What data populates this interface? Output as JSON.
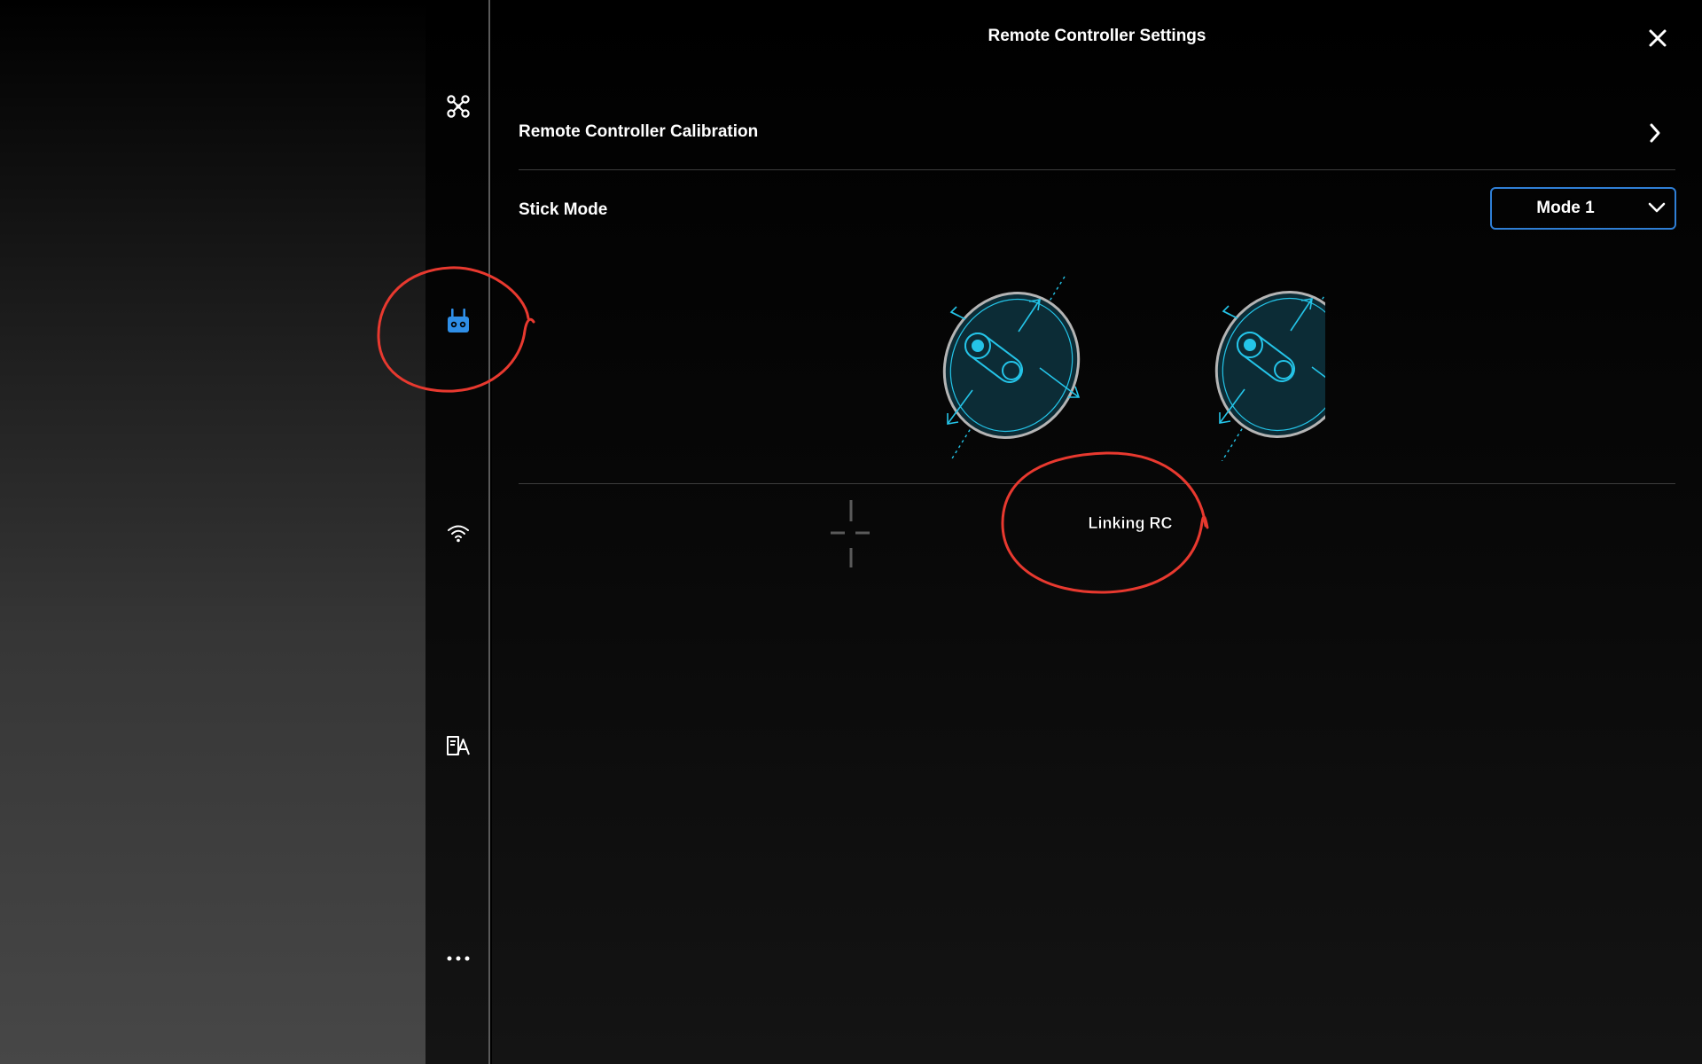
{
  "header": {
    "title": "Remote Controller Settings",
    "close_icon": "close-icon"
  },
  "sidebar": {
    "items": [
      {
        "name": "aircraft",
        "icon": "drone-icon",
        "active": false
      },
      {
        "name": "remote-controller",
        "icon": "remote-controller-icon",
        "active": true
      },
      {
        "name": "transmission",
        "icon": "wifi-icon",
        "active": false
      },
      {
        "name": "language",
        "icon": "translate-icon",
        "active": false
      },
      {
        "name": "more",
        "icon": "more-icon",
        "active": false
      }
    ]
  },
  "settings": {
    "calibration_label": "Remote Controller Calibration",
    "stick_mode_label": "Stick Mode",
    "stick_mode_value": "Mode 1"
  },
  "linking": {
    "label": "Linking RC"
  },
  "colors": {
    "accent_blue": "#2f7fd6",
    "stick_cyan": "#24c4e8",
    "annotation_red": "#e8392f"
  }
}
